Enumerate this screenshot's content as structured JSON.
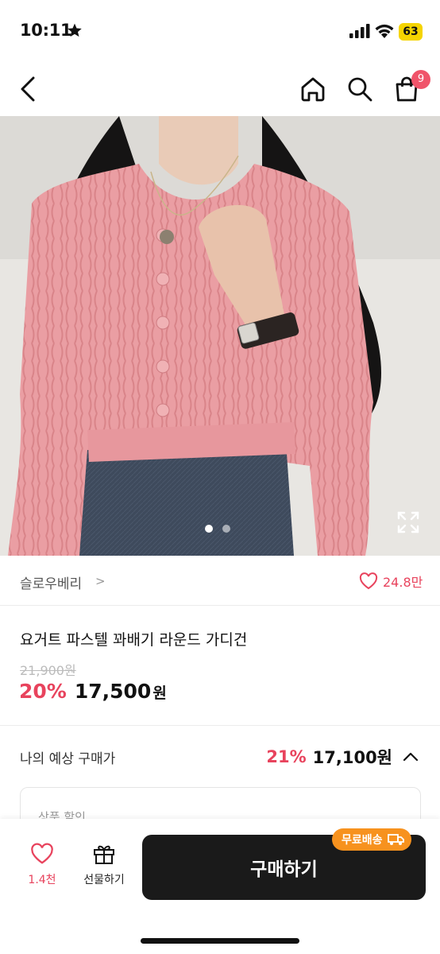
{
  "status_bar": {
    "time": "10:11",
    "battery": "63",
    "battery_color": "#f5d400"
  },
  "nav": {
    "back_icon": "chevron-left-icon",
    "home_icon": "home-icon",
    "search_icon": "search-icon",
    "cart_icon": "shopping-bag-icon",
    "cart_badge": "9",
    "badge_color": "#f0546a"
  },
  "gallery": {
    "image_count": 2,
    "active_index": 0,
    "expand_icon": "expand-icon"
  },
  "brand": {
    "name": "슬로우베리",
    "chevron": ">",
    "like_count": "24.8만"
  },
  "product": {
    "title": "요거트 파스텔 꽈배기 라운드 가디건",
    "original_price": "21,900원",
    "discount_rate": "20%",
    "sale_price": "17,500",
    "sale_unit": "원"
  },
  "expected": {
    "label": "나의 예상 구매가",
    "rate": "21%",
    "price": "17,100원"
  },
  "coupon": {
    "label": "상품 할인"
  },
  "bottom_bar": {
    "wish_count": "1.4천",
    "gift_label": "선물하기",
    "buy_label": "구매하기",
    "shipping_badge": "무료배송"
  },
  "colors": {
    "accent": "#e8435d",
    "buy_button": "#1a1a1a",
    "shipping_badge": "#f7921e"
  }
}
